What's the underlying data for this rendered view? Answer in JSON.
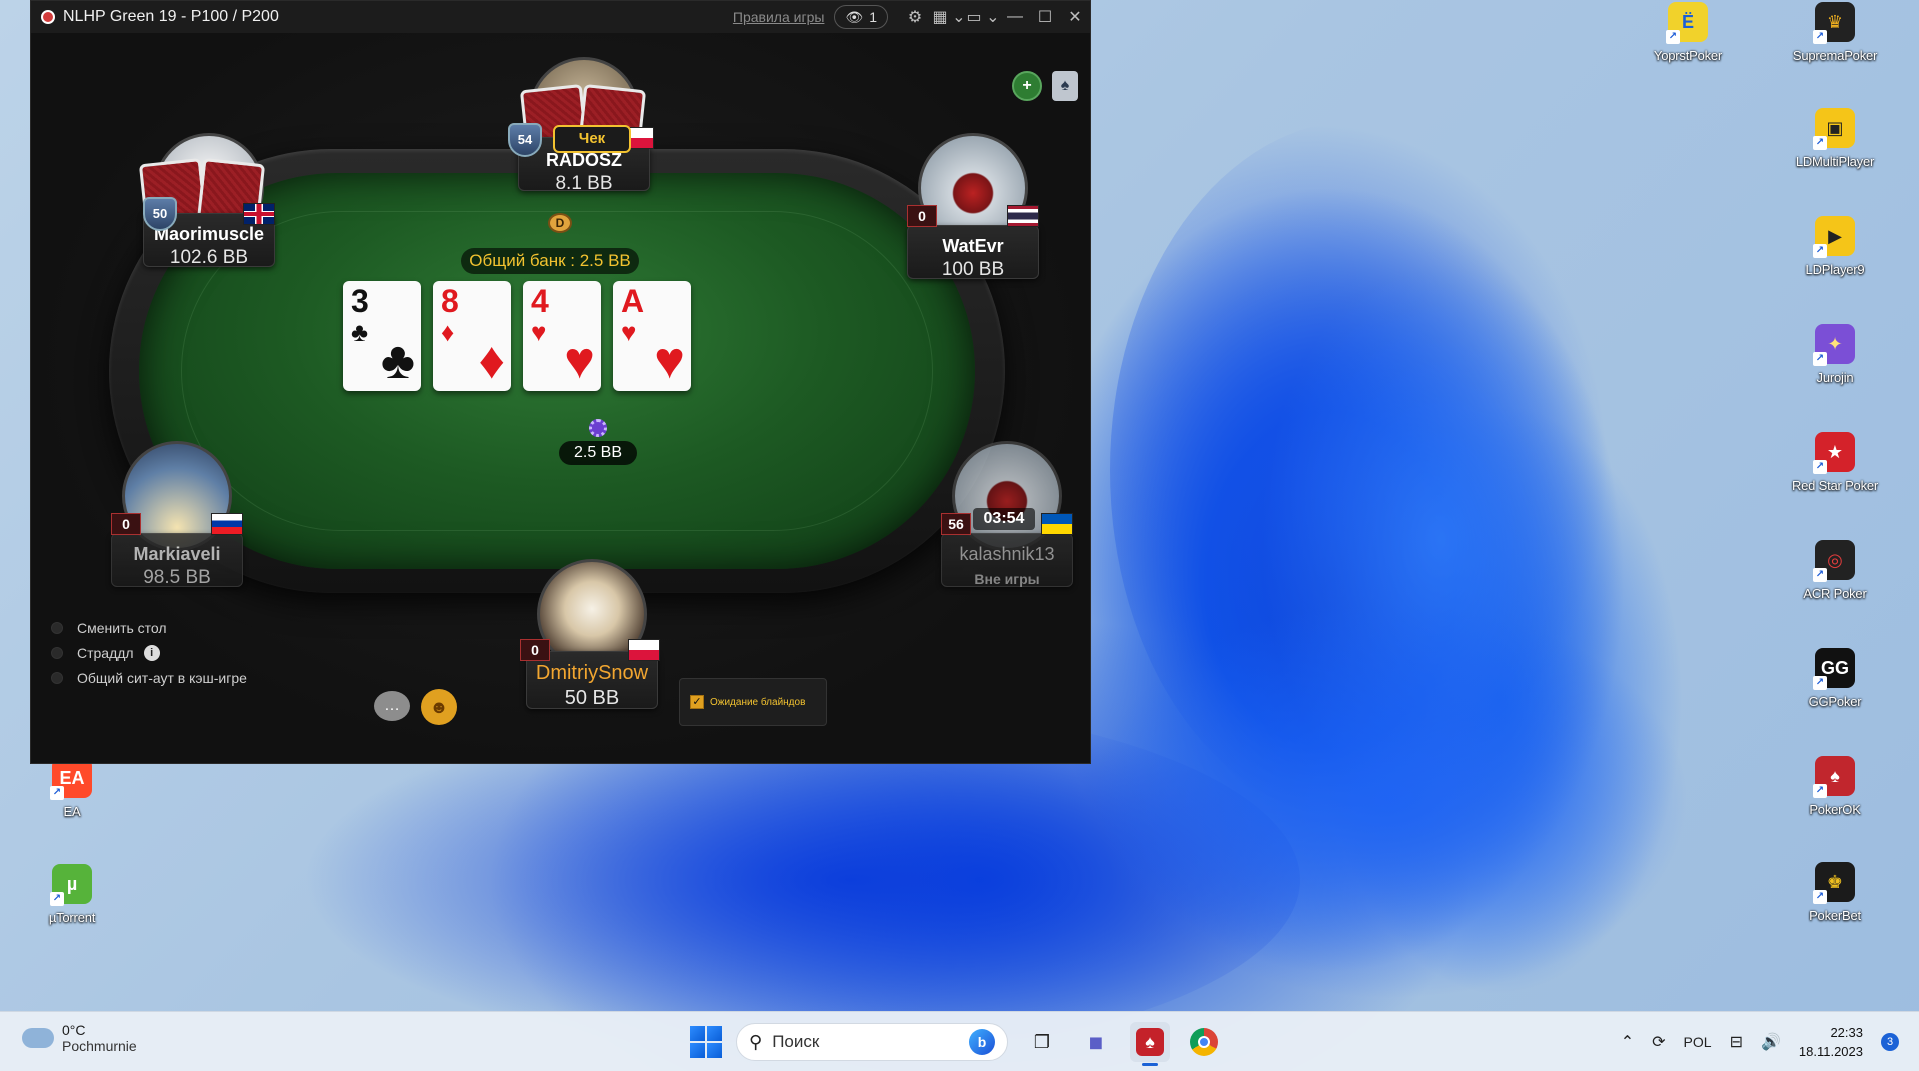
{
  "window": {
    "title": "NLHP Green 19 - P100 / P200",
    "rules_link": "Правила игры",
    "watchers": "1"
  },
  "table": {
    "pot_label": "Общий банк : 2.5 BB",
    "bet_amount": "2.5 BB",
    "dealer_button": "D",
    "board": [
      {
        "rank": "3",
        "suit": "♣",
        "color": "black"
      },
      {
        "rank": "8",
        "suit": "♦",
        "color": "red"
      },
      {
        "rank": "4",
        "suit": "♥",
        "color": "red"
      },
      {
        "rank": "A",
        "suit": "♥",
        "color": "red"
      }
    ]
  },
  "players": {
    "radosz": {
      "name": "RADOSZ",
      "stack": "8.1 BB",
      "level": "54",
      "action": "Чек",
      "flag": "Poland"
    },
    "maorimuscle": {
      "name": "Maorimuscle",
      "stack": "102.6 BB",
      "level": "50",
      "flag": "United Kingdom"
    },
    "watevr": {
      "name": "WatEvr",
      "stack": "100 BB",
      "level": "0",
      "flag": "Thailand"
    },
    "markiaveli": {
      "name": "Markiaveli",
      "stack": "98.5 BB",
      "level": "0",
      "flag": "Slovenia"
    },
    "kalashnik13": {
      "name": "kalashnik13",
      "stack": "Вне игры",
      "level": "56",
      "timer": "03:54",
      "flag": "Ukraine"
    },
    "dmitriysnow": {
      "name": "DmitriySnow",
      "stack": "50 BB",
      "level": "0",
      "flag": "Poland"
    }
  },
  "options": {
    "change_table": "Сменить стол",
    "straddle": "Страддл",
    "sitout": "Общий сит-аут в кэш-игре",
    "wait_blinds": "Ожидание блайндов"
  },
  "desktop_icons": {
    "yoprst": "YoprstPoker",
    "suprema": "SupremaPoker",
    "ldmulti": "LDMultiPlayer",
    "ldplayer9": "LDPlayer9",
    "jurojin": "Jurojin",
    "redstar": "Red Star Poker",
    "acr": "ACR Poker",
    "ggpoker": "GGPoker",
    "pokerok": "PokerOK",
    "pokerbet": "PokerBet",
    "ea": "EA",
    "utorrent": "µTorrent"
  },
  "taskbar": {
    "temperature": "0°C",
    "weather": "Pochmurnie",
    "search_placeholder": "Поиск",
    "language": "POL",
    "time": "22:33",
    "date": "18.11.2023",
    "notifications": "3"
  },
  "colors": {
    "felt": "#1d5a23",
    "accent_gold": "#f2c230",
    "card_red": "#e0191f",
    "taskbar": "#e8eef6"
  }
}
